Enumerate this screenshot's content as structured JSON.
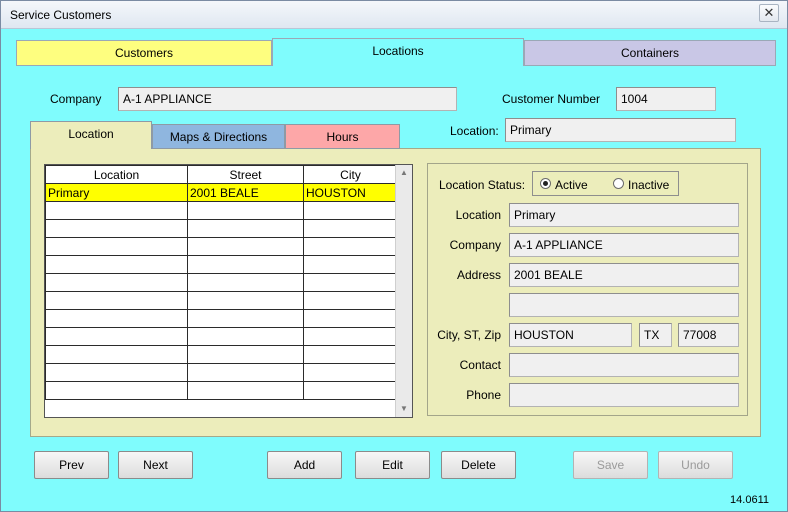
{
  "window": {
    "title": "Service Customers",
    "close_symbol": "✕"
  },
  "main_tabs": [
    {
      "label": "Customers",
      "color": "#fefe7f"
    },
    {
      "label": "Locations",
      "color": "#7ffcfd"
    },
    {
      "label": "Containers",
      "color": "#c9c7e6"
    }
  ],
  "company": {
    "label": "Company",
    "value": "A-1 APPLIANCE"
  },
  "customer_number": {
    "label": "Customer Number",
    "value": "1004"
  },
  "location_header": {
    "label": "Location:",
    "value": "Primary"
  },
  "sub_tabs": [
    {
      "label": "Location",
      "color": "#ecedbb"
    },
    {
      "label": "Maps & Directions",
      "color": "#8fb6df"
    },
    {
      "label": "Hours",
      "color": "#fda7a8"
    }
  ],
  "grid": {
    "columns": [
      "Location",
      "Street",
      "City"
    ],
    "rows": [
      [
        "Primary",
        "2001 BEALE",
        "HOUSTON"
      ],
      [
        "",
        "",
        ""
      ],
      [
        "",
        "",
        ""
      ],
      [
        "",
        "",
        ""
      ],
      [
        "",
        "",
        ""
      ],
      [
        "",
        "",
        ""
      ],
      [
        "",
        "",
        ""
      ],
      [
        "",
        "",
        ""
      ],
      [
        "",
        "",
        ""
      ],
      [
        "",
        "",
        ""
      ],
      [
        "",
        "",
        ""
      ],
      [
        "",
        "",
        ""
      ]
    ]
  },
  "detail": {
    "status_label": "Location Status:",
    "status_options": [
      "Active",
      "Inactive"
    ],
    "status_selected": "Active",
    "location_label": "Location",
    "location_value": "Primary",
    "company_label": "Company",
    "company_value": "A-1 APPLIANCE",
    "address_label": "Address",
    "address1_value": "2001 BEALE",
    "address2_value": "",
    "csz_label": "City, ST, Zip",
    "city_value": "HOUSTON",
    "state_value": "TX",
    "zip_value": "77008",
    "contact_label": "Contact",
    "contact_value": "",
    "phone_label": "Phone",
    "phone_value": ""
  },
  "buttons": {
    "prev": "Prev",
    "next": "Next",
    "add": "Add",
    "edit": "Edit",
    "delete": "Delete",
    "save": "Save",
    "undo": "Undo"
  },
  "version": "14.0611"
}
